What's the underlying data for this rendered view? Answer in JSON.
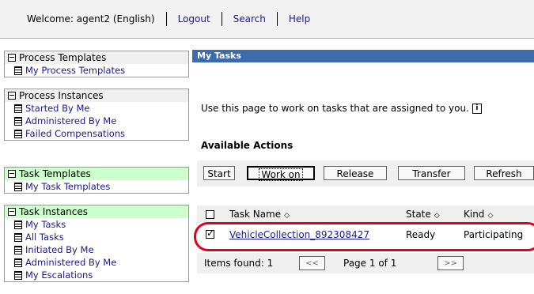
{
  "header": {
    "welcome": "Welcome: agent2 (English)",
    "logout": "Logout",
    "search": "Search",
    "help": "Help"
  },
  "nav": {
    "process_templates": {
      "title": "Process Templates",
      "items": [
        "My Process Templates"
      ]
    },
    "process_instances": {
      "title": "Process Instances",
      "items": [
        "Started By Me",
        "Administered By Me",
        "Failed Compensations"
      ]
    },
    "task_templates": {
      "title": "Task Templates",
      "items": [
        "My Task Templates"
      ]
    },
    "task_instances": {
      "title": "Task Instances",
      "items": [
        "My Tasks",
        "All Tasks",
        "Initiated By Me",
        "Administered By Me",
        "My Escalations"
      ]
    }
  },
  "main": {
    "title": "My Tasks",
    "intro": "Use this page to work on tasks that are assigned to you.",
    "actions_title": "Available Actions",
    "actions": [
      "Start",
      "Work on",
      "Release",
      "Transfer",
      "Refresh"
    ],
    "columns": {
      "task_name": "Task Name",
      "state": "State",
      "kind": "Kind"
    },
    "rows": [
      {
        "task_name": "VehicleCollection_892308427",
        "state": "Ready",
        "kind": "Participating",
        "checked": true
      }
    ],
    "items_found": "Items found: 1",
    "prev": "<<",
    "page": "Page 1 of 1",
    "next": ">>"
  },
  "colors": {
    "title_bar": "#3c6cac",
    "highlight_oval": "#e3001b",
    "task_nav_header": "#ccffcc"
  }
}
